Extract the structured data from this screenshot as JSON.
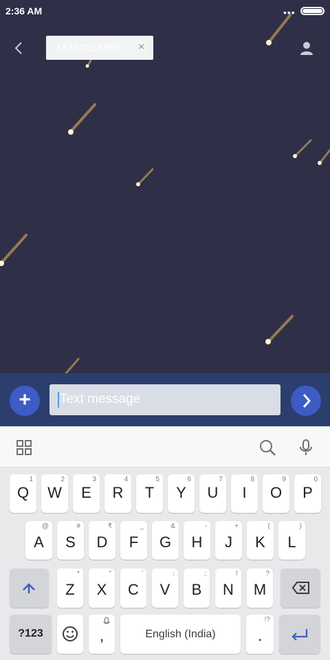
{
  "status_bar": {
    "time": "2:36 AM",
    "more": "•••",
    "battery_level": 1.0
  },
  "header": {
    "recipient": "18730218809",
    "chip_close": "×",
    "back_icon": "chevron-left-icon",
    "contact_icon": "person-icon"
  },
  "composer": {
    "placeholder": "Text message",
    "add_icon": "plus-icon",
    "send_icon": "chevron-right-icon"
  },
  "keyboard_toolbar": {
    "icons": [
      "grid-icon",
      "search-icon",
      "microphone-icon"
    ]
  },
  "keyboard": {
    "row1": [
      {
        "label": "Q",
        "hint": "1"
      },
      {
        "label": "W",
        "hint": "2"
      },
      {
        "label": "E",
        "hint": "3"
      },
      {
        "label": "R",
        "hint": "4"
      },
      {
        "label": "T",
        "hint": "5"
      },
      {
        "label": "Y",
        "hint": "6"
      },
      {
        "label": "U",
        "hint": "7"
      },
      {
        "label": "I",
        "hint": "8"
      },
      {
        "label": "O",
        "hint": "9"
      },
      {
        "label": "P",
        "hint": "0"
      }
    ],
    "row2": [
      {
        "label": "A",
        "hint": "@"
      },
      {
        "label": "S",
        "hint": "#"
      },
      {
        "label": "D",
        "hint": "₹"
      },
      {
        "label": "F",
        "hint": "_"
      },
      {
        "label": "G",
        "hint": "&"
      },
      {
        "label": "H",
        "hint": "-"
      },
      {
        "label": "J",
        "hint": "+"
      },
      {
        "label": "K",
        "hint": "("
      },
      {
        "label": "L",
        "hint": ")"
      }
    ],
    "row3": [
      {
        "label": "Z",
        "hint": "*"
      },
      {
        "label": "X",
        "hint": "\""
      },
      {
        "label": "C",
        "hint": "'"
      },
      {
        "label": "V",
        "hint": ":"
      },
      {
        "label": "B",
        "hint": ";"
      },
      {
        "label": "N",
        "hint": "!"
      },
      {
        "label": "M",
        "hint": "?"
      }
    ],
    "symbols_label": "?123",
    "comma_label": ",",
    "space_label": "English (India)",
    "period_label": ".",
    "period_hint": "!?",
    "shift_icon": "shift-arrow-icon",
    "backspace_icon": "backspace-icon",
    "emoji_icon": "emoji-icon",
    "enter_icon": "enter-icon",
    "accent_color": "#3d5cc4"
  }
}
